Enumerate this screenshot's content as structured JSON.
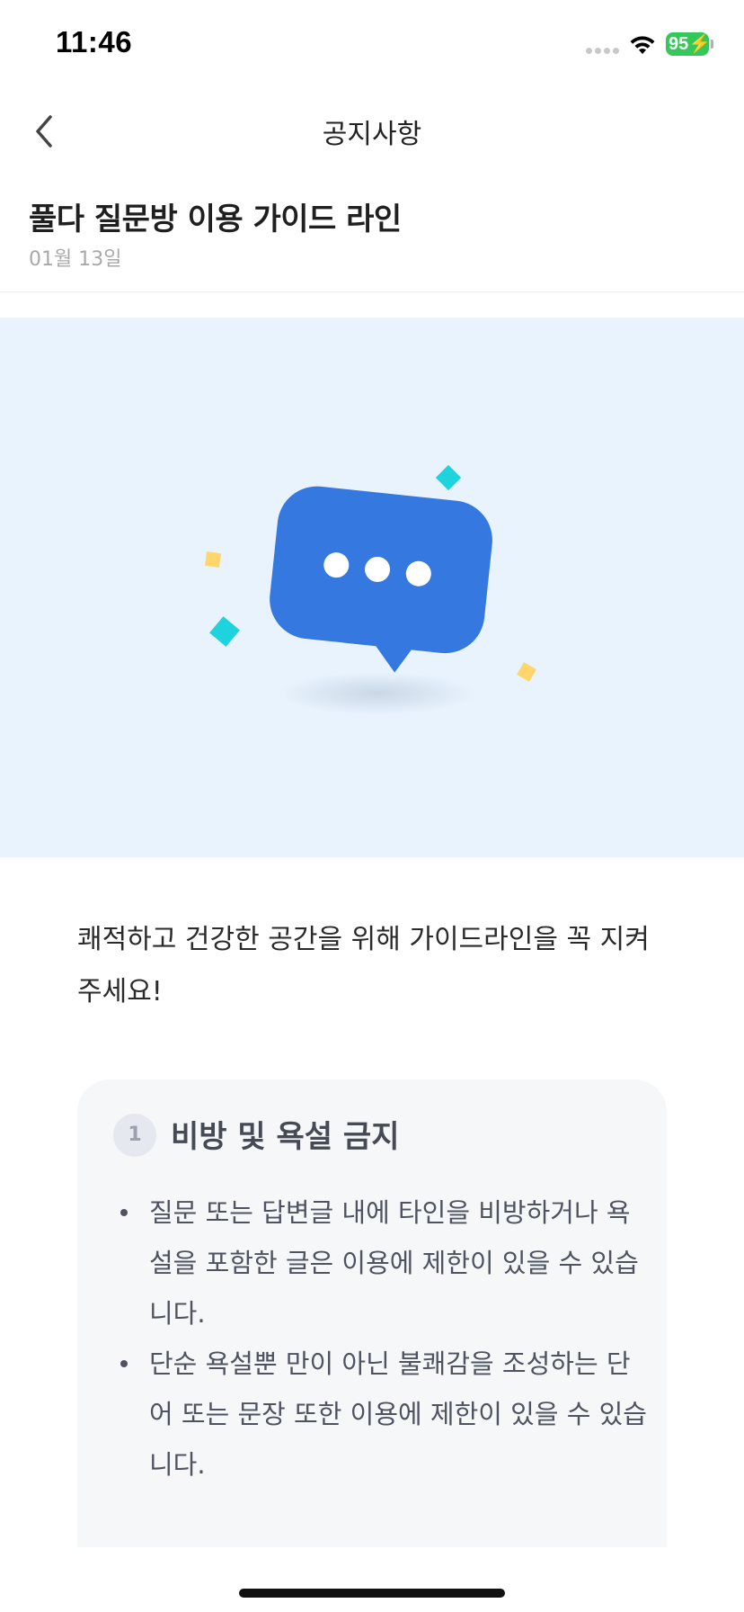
{
  "status_bar": {
    "time": "11:46",
    "battery": "95",
    "icons": [
      "signal-icon",
      "wifi-icon",
      "battery-icon"
    ]
  },
  "nav": {
    "title": "공지사항",
    "back_icon": "chevron-left-icon"
  },
  "post": {
    "title": "풀다 질문방 이용 가이드 라인",
    "date": "01월 13일"
  },
  "banner": {
    "icon": "chat-bubble-icon",
    "background": "#e8f3fd",
    "accent": "#3478e0"
  },
  "intro": "쾌적하고 건강한 공간을 위해 가이드라인을 꼭 지켜주세요!",
  "rules": [
    {
      "number": "1",
      "title": "비방 및 욕설 금지",
      "items": [
        "질문 또는 답변글 내에 타인을 비방하거나 욕설을 포함한 글은 이용에 제한이 있을 수 있습니다.",
        "단순 욕설뿐 만이 아닌 불쾌감을 조성하는 단어 또는 문장 또한 이용에 제한이 있을 수 있습니다."
      ]
    }
  ]
}
